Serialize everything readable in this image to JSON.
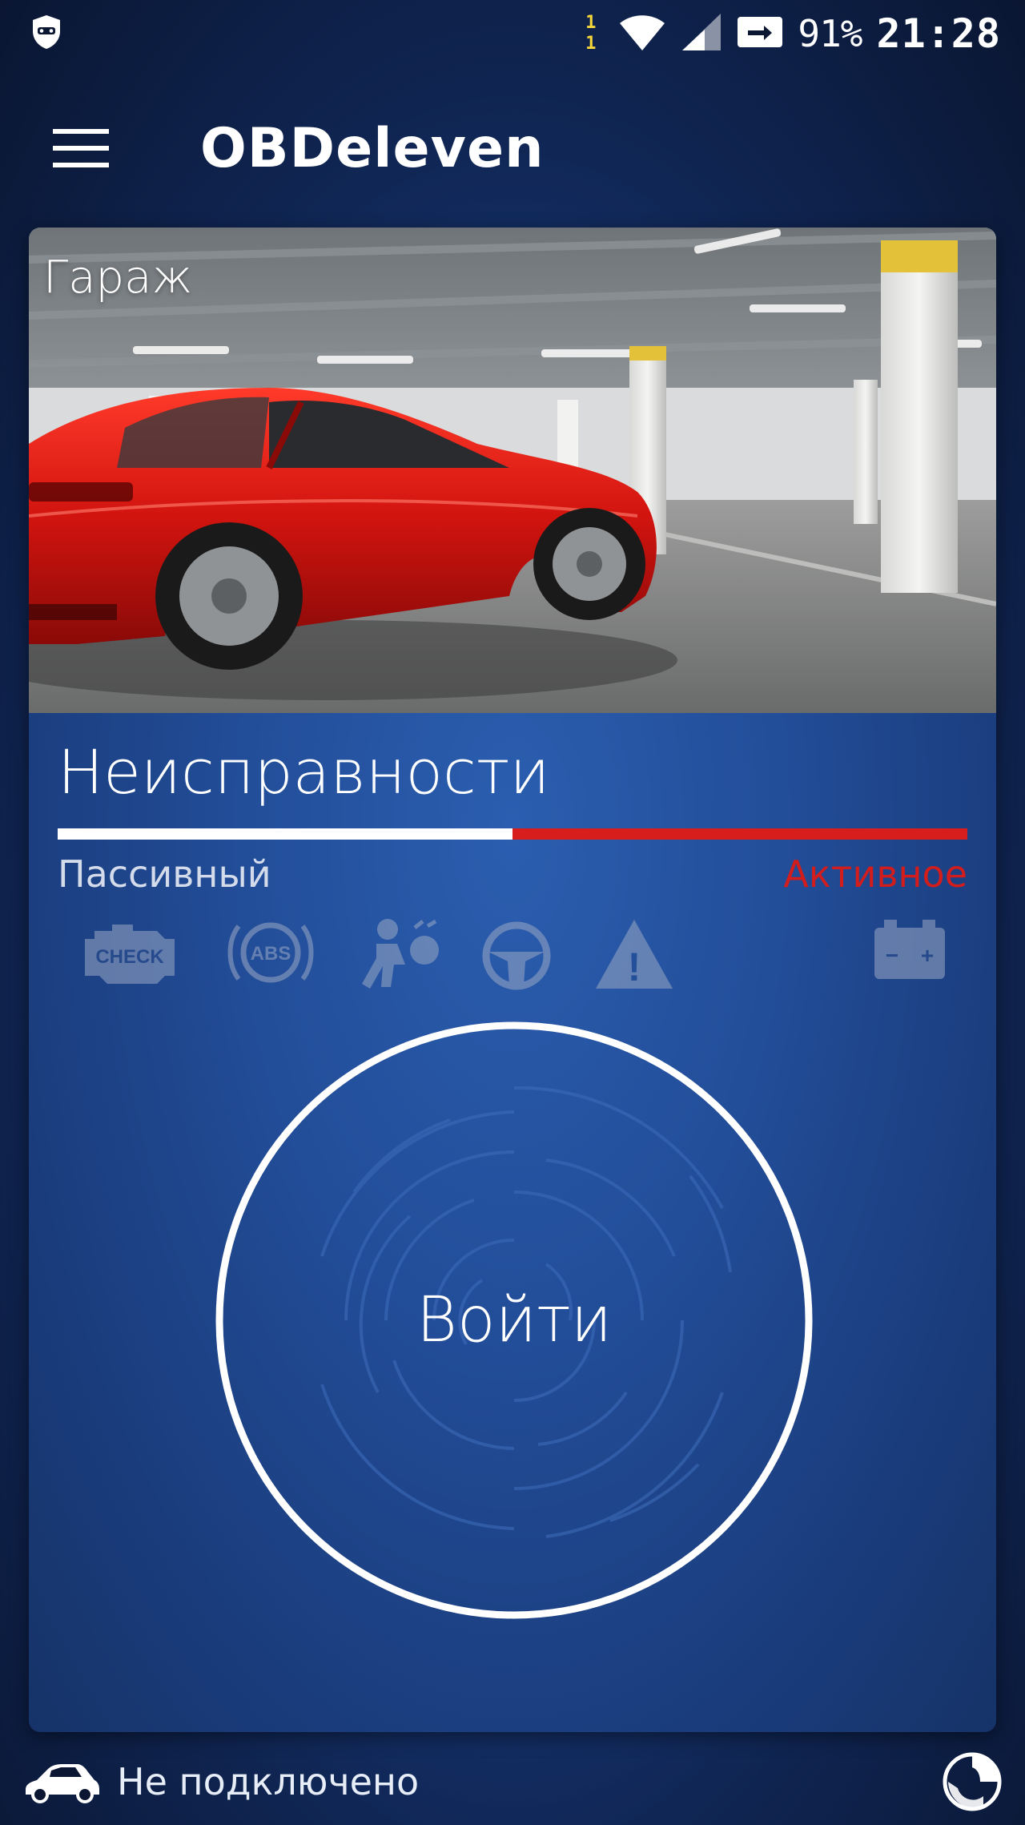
{
  "status_bar": {
    "sim_slot_top": "1",
    "sim_slot_bottom": "1",
    "battery": "91%",
    "clock": "21:28",
    "icons": [
      "shield-notification-icon",
      "wifi-icon",
      "cell-signal-icon",
      "cast-icon"
    ]
  },
  "app_bar": {
    "menu_icon": "hamburger-menu-icon",
    "title": "OBDeleven"
  },
  "garage": {
    "label": "Гараж",
    "image": "red-sports-car-in-parking-garage"
  },
  "faults": {
    "title": "Неисправности",
    "passive_label": "Пассивный",
    "active_label": "Активное",
    "passive_fraction": 0.5,
    "active_fraction": 0.5,
    "passive_color": "#ffffff",
    "active_color": "#d81d1d"
  },
  "warning_icons": [
    "check-engine-icon",
    "abs-icon",
    "airbag-icon",
    "steering-wheel-icon",
    "warning-triangle-icon",
    "battery-icon"
  ],
  "warning_icon_texts": {
    "check": "CHECK",
    "abs": "ABS",
    "exclamation": "!",
    "battery_minus": "−",
    "battery_plus": "+"
  },
  "login": {
    "label": "Войти"
  },
  "connection": {
    "status": "Не подключено",
    "car_icon": "car-icon",
    "action_icon": "connect-circle-icon"
  },
  "colors": {
    "background": "#0a1632",
    "card": "#224d98",
    "accent_red": "#d81d1d"
  }
}
